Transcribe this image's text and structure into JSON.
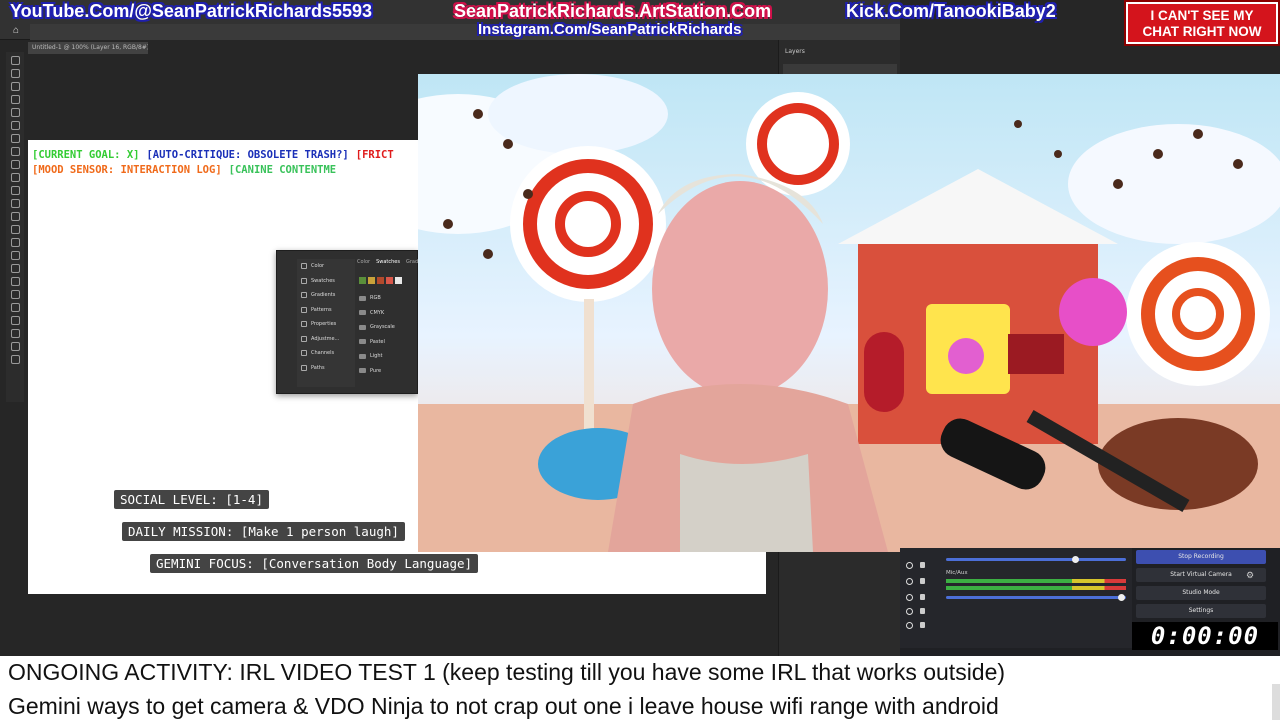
{
  "header": {
    "youtube": "YouTube.Com/@SeanPatrickRichards5593",
    "artstation": "SeanPatrickRichards.ArtStation.Com",
    "kick": "Kick.Com/TanookiBaby2",
    "instagram": "Instagram.Com/SeanPatrickRichards",
    "chat_alert_line1": "I CAN'T SEE MY",
    "chat_alert_line2": "CHAT RIGHT NOW"
  },
  "photoshop": {
    "doc_tab": "Untitled-1 @ 100% (Layer 16, RGB/8#) *",
    "right_panel_tab": "Layers",
    "swatch_panel": {
      "sidebar": [
        "Color",
        "Swatches",
        "Gradients",
        "Patterns",
        "Properties",
        "Adjustme...",
        "Channels",
        "Paths"
      ],
      "tabs": [
        "Color",
        "Swatches",
        "Gradi"
      ],
      "folders": [
        "RGB",
        "CMYK",
        "Grayscale",
        "Pastel",
        "Light",
        "Pure"
      ]
    }
  },
  "hud": {
    "line1": [
      {
        "text": "[CURRENT GOAL: X]",
        "color": "#33cc33"
      },
      {
        "text": "[AUTO-CRITIQUE: OBSOLETE TRASH?]",
        "color": "#1a2fb8"
      },
      {
        "text": "[FRICT",
        "color": "#e01b1b"
      }
    ],
    "line2": [
      {
        "text": "[MOOD SENSOR: INTERACTION LOG]",
        "color": "#f06a1a"
      },
      {
        "text": "[CANINE CONTENTME",
        "color": "#39c25a"
      }
    ]
  },
  "status_boxes": {
    "social_level": "SOCIAL LEVEL: [1-4]",
    "daily_mission": "DAILY MISSION: [Make 1 person laugh]",
    "gemini_focus": "GEMINI FOCUS: [Conversation Body Language]"
  },
  "obs": {
    "mixer_label": "Mic/Aux",
    "controls": {
      "stop_recording": "Stop Recording",
      "start_virtual_camera": "Start Virtual Camera",
      "studio_mode": "Studio Mode",
      "settings": "Settings"
    },
    "timer": "0:00:00"
  },
  "ticker": {
    "line1": "ONGOING ACTIVITY: IRL VIDEO TEST 1 (keep testing till you have some IRL that works outside)",
    "line2": "Gemini ways to get camera & VDO Ninja to not crap out one i leave house wifi range with android"
  },
  "colors": {
    "header_outline_blue": "#1f1fb0",
    "header_outline_pink": "#d0104a",
    "chat_alert_red": "#d4141c",
    "obs_record_blue": "#3d4fb0"
  }
}
